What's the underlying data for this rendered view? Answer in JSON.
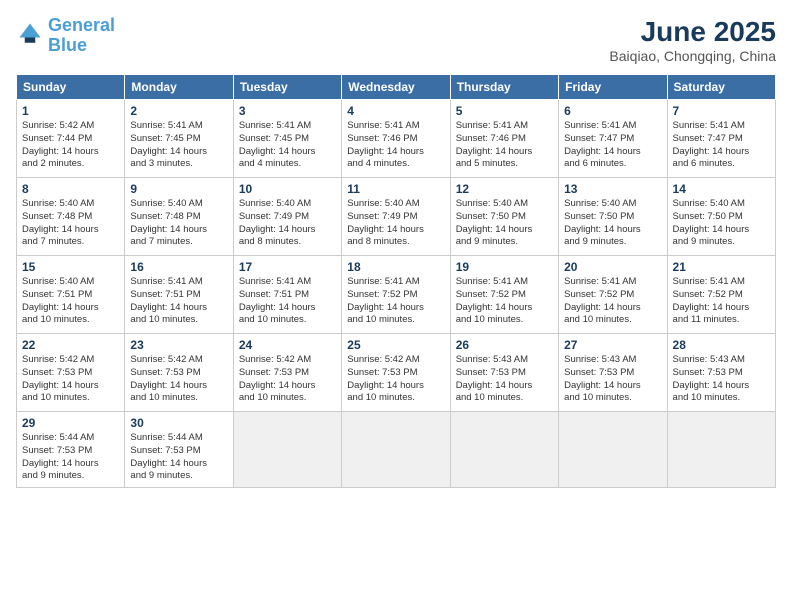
{
  "logo": {
    "line1": "General",
    "line2": "Blue"
  },
  "title": "June 2025",
  "location": "Baiqiao, Chongqing, China",
  "weekdays": [
    "Sunday",
    "Monday",
    "Tuesday",
    "Wednesday",
    "Thursday",
    "Friday",
    "Saturday"
  ],
  "weeks": [
    [
      {
        "day": "1",
        "info": "Sunrise: 5:42 AM\nSunset: 7:44 PM\nDaylight: 14 hours\nand 2 minutes."
      },
      {
        "day": "2",
        "info": "Sunrise: 5:41 AM\nSunset: 7:45 PM\nDaylight: 14 hours\nand 3 minutes."
      },
      {
        "day": "3",
        "info": "Sunrise: 5:41 AM\nSunset: 7:45 PM\nDaylight: 14 hours\nand 4 minutes."
      },
      {
        "day": "4",
        "info": "Sunrise: 5:41 AM\nSunset: 7:46 PM\nDaylight: 14 hours\nand 4 minutes."
      },
      {
        "day": "5",
        "info": "Sunrise: 5:41 AM\nSunset: 7:46 PM\nDaylight: 14 hours\nand 5 minutes."
      },
      {
        "day": "6",
        "info": "Sunrise: 5:41 AM\nSunset: 7:47 PM\nDaylight: 14 hours\nand 6 minutes."
      },
      {
        "day": "7",
        "info": "Sunrise: 5:41 AM\nSunset: 7:47 PM\nDaylight: 14 hours\nand 6 minutes."
      }
    ],
    [
      {
        "day": "8",
        "info": "Sunrise: 5:40 AM\nSunset: 7:48 PM\nDaylight: 14 hours\nand 7 minutes."
      },
      {
        "day": "9",
        "info": "Sunrise: 5:40 AM\nSunset: 7:48 PM\nDaylight: 14 hours\nand 7 minutes."
      },
      {
        "day": "10",
        "info": "Sunrise: 5:40 AM\nSunset: 7:49 PM\nDaylight: 14 hours\nand 8 minutes."
      },
      {
        "day": "11",
        "info": "Sunrise: 5:40 AM\nSunset: 7:49 PM\nDaylight: 14 hours\nand 8 minutes."
      },
      {
        "day": "12",
        "info": "Sunrise: 5:40 AM\nSunset: 7:50 PM\nDaylight: 14 hours\nand 9 minutes."
      },
      {
        "day": "13",
        "info": "Sunrise: 5:40 AM\nSunset: 7:50 PM\nDaylight: 14 hours\nand 9 minutes."
      },
      {
        "day": "14",
        "info": "Sunrise: 5:40 AM\nSunset: 7:50 PM\nDaylight: 14 hours\nand 9 minutes."
      }
    ],
    [
      {
        "day": "15",
        "info": "Sunrise: 5:40 AM\nSunset: 7:51 PM\nDaylight: 14 hours\nand 10 minutes."
      },
      {
        "day": "16",
        "info": "Sunrise: 5:41 AM\nSunset: 7:51 PM\nDaylight: 14 hours\nand 10 minutes."
      },
      {
        "day": "17",
        "info": "Sunrise: 5:41 AM\nSunset: 7:51 PM\nDaylight: 14 hours\nand 10 minutes."
      },
      {
        "day": "18",
        "info": "Sunrise: 5:41 AM\nSunset: 7:52 PM\nDaylight: 14 hours\nand 10 minutes."
      },
      {
        "day": "19",
        "info": "Sunrise: 5:41 AM\nSunset: 7:52 PM\nDaylight: 14 hours\nand 10 minutes."
      },
      {
        "day": "20",
        "info": "Sunrise: 5:41 AM\nSunset: 7:52 PM\nDaylight: 14 hours\nand 10 minutes."
      },
      {
        "day": "21",
        "info": "Sunrise: 5:41 AM\nSunset: 7:52 PM\nDaylight: 14 hours\nand 11 minutes."
      }
    ],
    [
      {
        "day": "22",
        "info": "Sunrise: 5:42 AM\nSunset: 7:53 PM\nDaylight: 14 hours\nand 10 minutes."
      },
      {
        "day": "23",
        "info": "Sunrise: 5:42 AM\nSunset: 7:53 PM\nDaylight: 14 hours\nand 10 minutes."
      },
      {
        "day": "24",
        "info": "Sunrise: 5:42 AM\nSunset: 7:53 PM\nDaylight: 14 hours\nand 10 minutes."
      },
      {
        "day": "25",
        "info": "Sunrise: 5:42 AM\nSunset: 7:53 PM\nDaylight: 14 hours\nand 10 minutes."
      },
      {
        "day": "26",
        "info": "Sunrise: 5:43 AM\nSunset: 7:53 PM\nDaylight: 14 hours\nand 10 minutes."
      },
      {
        "day": "27",
        "info": "Sunrise: 5:43 AM\nSunset: 7:53 PM\nDaylight: 14 hours\nand 10 minutes."
      },
      {
        "day": "28",
        "info": "Sunrise: 5:43 AM\nSunset: 7:53 PM\nDaylight: 14 hours\nand 10 minutes."
      }
    ],
    [
      {
        "day": "29",
        "info": "Sunrise: 5:44 AM\nSunset: 7:53 PM\nDaylight: 14 hours\nand 9 minutes."
      },
      {
        "day": "30",
        "info": "Sunrise: 5:44 AM\nSunset: 7:53 PM\nDaylight: 14 hours\nand 9 minutes."
      },
      null,
      null,
      null,
      null,
      null
    ]
  ]
}
